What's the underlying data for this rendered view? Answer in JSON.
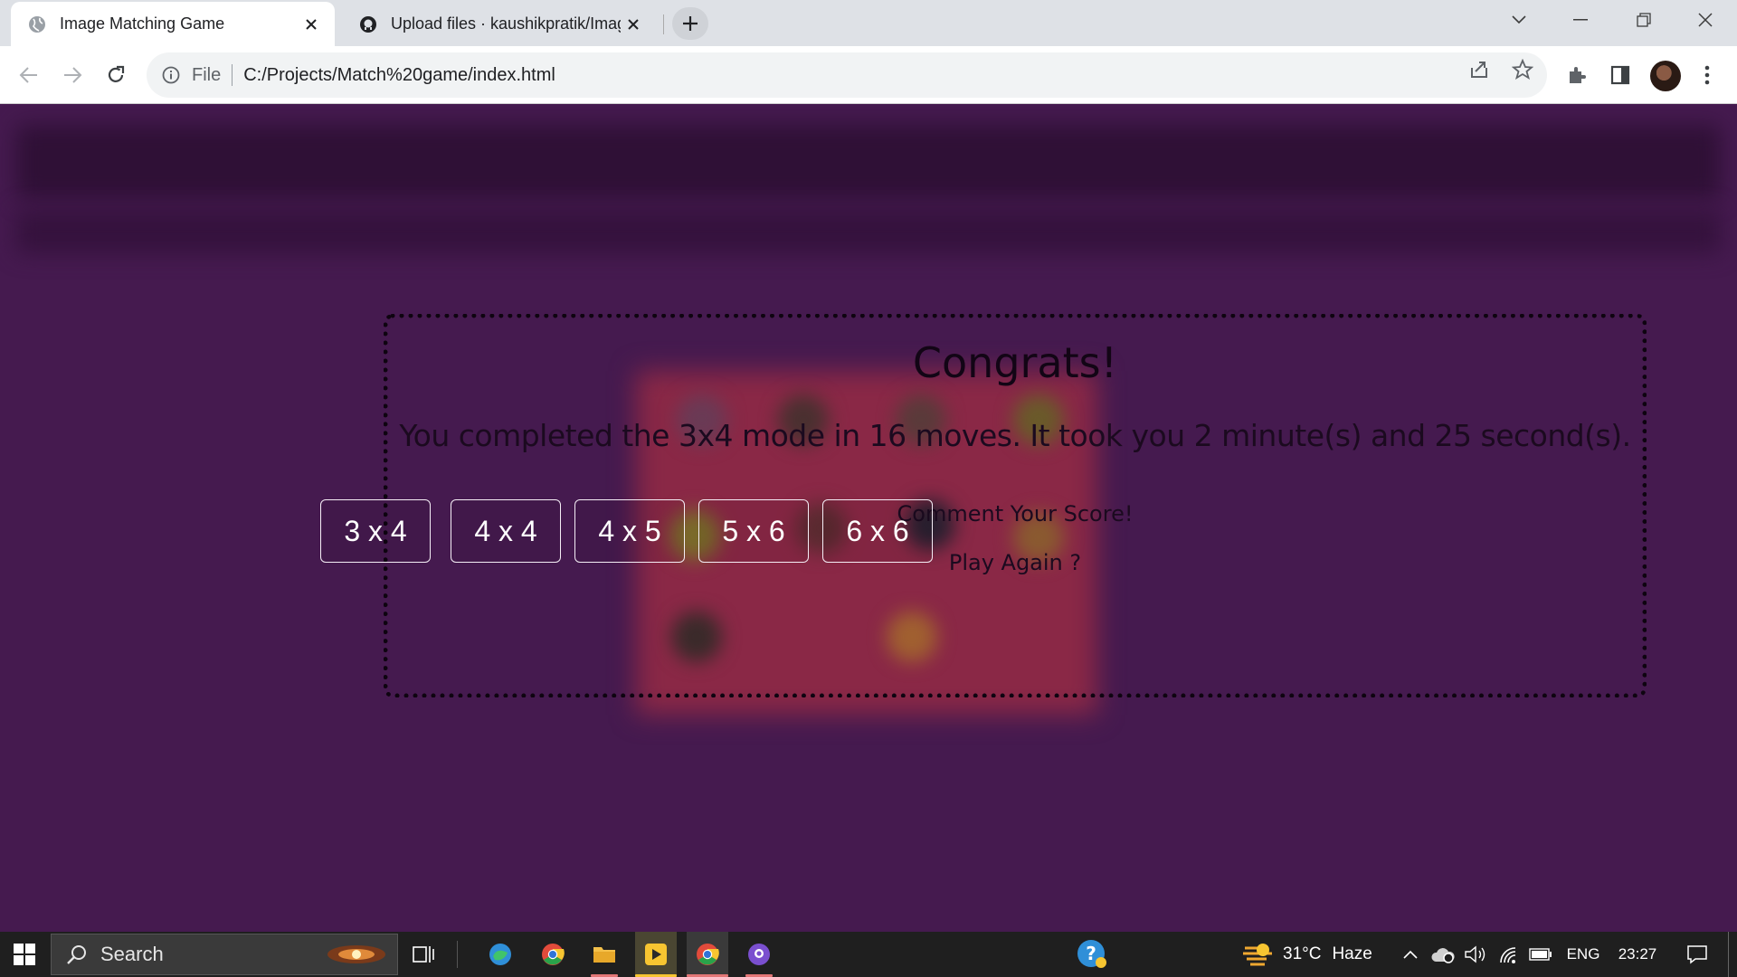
{
  "browser": {
    "tabs": [
      {
        "title": "Image Matching Game",
        "active": true
      },
      {
        "title": "Upload files · kaushikpratik/Imag",
        "active": false
      }
    ],
    "address": {
      "scheme": "File",
      "url": "C:/Projects/Match%20game/index.html"
    }
  },
  "dialog": {
    "heading": "Congrats!",
    "result": "You completed the 3x4 mode in 16 moves. It took you 2 minute(s) and 25 second(s).",
    "comment": "Comment Your Score!",
    "play_again": "Play Again ?",
    "modes": [
      "3 x 4",
      "4 x 4",
      "4 x 5",
      "5 x 6",
      "6 x 6"
    ]
  },
  "taskbar": {
    "search_placeholder": "Search",
    "weather": {
      "temp": "31°C",
      "condition": "Haze"
    },
    "language": "ENG",
    "time": "23:27"
  },
  "colors": {
    "page_bg": "#451a4f",
    "board_blur": "#8a2846",
    "button_text": "#ffffff"
  }
}
